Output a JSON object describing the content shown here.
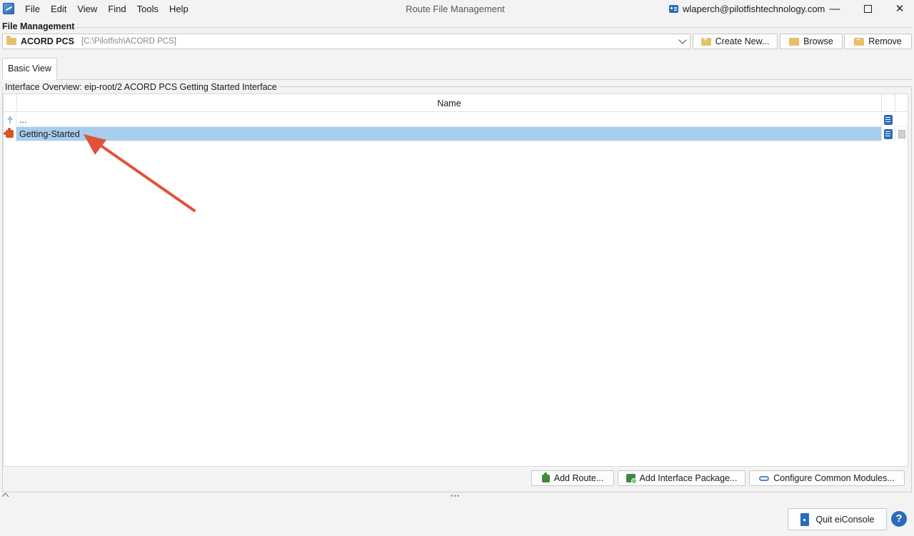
{
  "window": {
    "title": "Route File Management",
    "account": "wlaperch@pilotfishtechnology.com",
    "minimize": "—",
    "close": "✕"
  },
  "menu": [
    "File",
    "Edit",
    "View",
    "Find",
    "Tools",
    "Help"
  ],
  "file_management": {
    "label": "File Management",
    "folder_name": "ACORD PCS",
    "folder_path": "[C:\\Pilotfish\\ACORD PCS]",
    "create_label": "Create New...",
    "browse_label": "Browse",
    "remove_label": "Remove"
  },
  "tabs": [
    {
      "label": "Basic View",
      "active": true
    }
  ],
  "interface": {
    "title": "Interface Overview: eip-root/2 ACORD PCS Getting Started Interface",
    "column_name": "Name",
    "rows": [
      {
        "label": "...",
        "icon": "up-arrow-icon"
      },
      {
        "label": "Getting-Started",
        "icon": "puzzle-icon",
        "selected": true
      }
    ]
  },
  "actions": {
    "add_route": "Add Route...",
    "add_package": "Add Interface Package...",
    "configure_modules": "Configure Common Modules..."
  },
  "footer": {
    "drag_handle": "•••",
    "quit_label": "Quit eiConsole",
    "help_label": "?"
  },
  "colors": {
    "selection": "#a9cdec",
    "annotation_arrow": "#e0533a",
    "accent": "#2b6cb8"
  }
}
